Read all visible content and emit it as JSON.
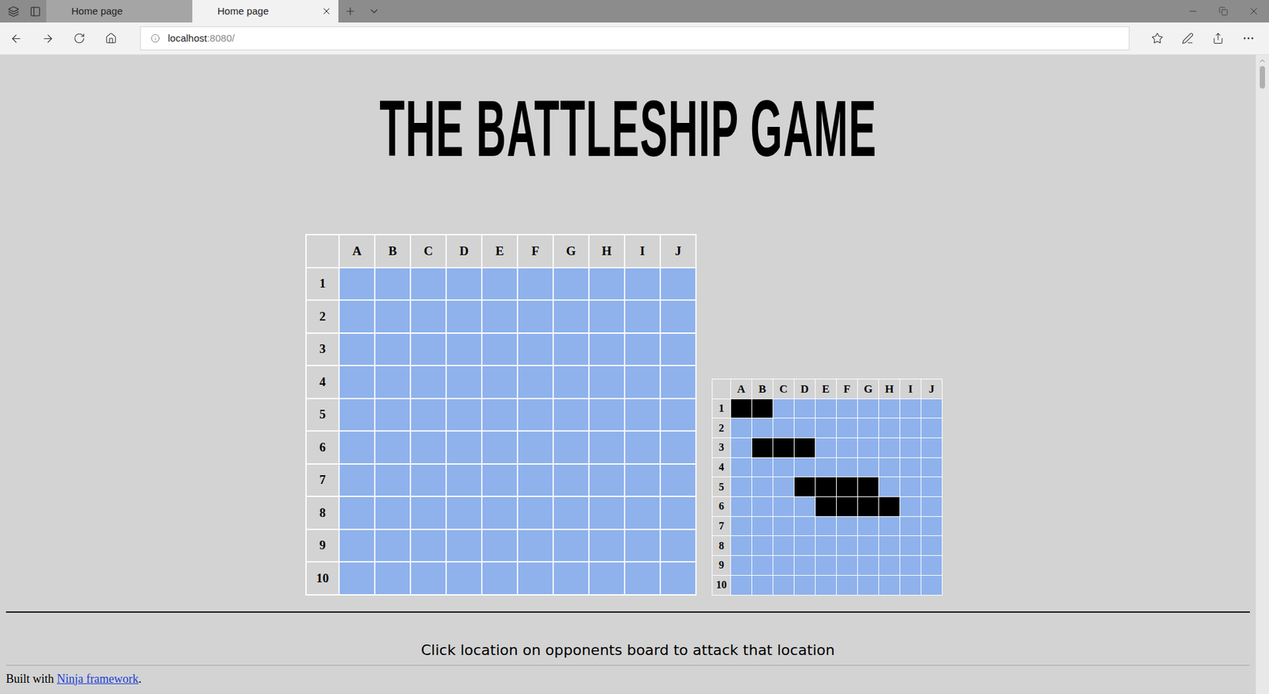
{
  "browser": {
    "tabs": [
      {
        "label": "Home page",
        "selected": false
      },
      {
        "label": "Home page",
        "selected": true
      }
    ],
    "url": {
      "host": "localhost",
      "rest": ":8080/"
    }
  },
  "title": "THE BATTLESHIP GAME",
  "opponent_board": {
    "columns": [
      "A",
      "B",
      "C",
      "D",
      "E",
      "F",
      "G",
      "H",
      "I",
      "J"
    ],
    "rows": [
      "1",
      "2",
      "3",
      "4",
      "5",
      "6",
      "7",
      "8",
      "9",
      "10"
    ]
  },
  "player_board": {
    "columns": [
      "A",
      "B",
      "C",
      "D",
      "E",
      "F",
      "G",
      "H",
      "I",
      "J"
    ],
    "rows": [
      {
        "label": "1",
        "ships": [
          true,
          true,
          false,
          false,
          false,
          false,
          false,
          false,
          false,
          false
        ]
      },
      {
        "label": "2",
        "ships": [
          false,
          false,
          false,
          false,
          false,
          false,
          false,
          false,
          false,
          false
        ]
      },
      {
        "label": "3",
        "ships": [
          false,
          true,
          true,
          true,
          false,
          false,
          false,
          false,
          false,
          false
        ]
      },
      {
        "label": "4",
        "ships": [
          false,
          false,
          false,
          false,
          false,
          false,
          false,
          false,
          false,
          false
        ]
      },
      {
        "label": "5",
        "ships": [
          false,
          false,
          false,
          true,
          true,
          true,
          true,
          false,
          false,
          false
        ]
      },
      {
        "label": "6",
        "ships": [
          false,
          false,
          false,
          false,
          true,
          true,
          true,
          true,
          false,
          false
        ]
      },
      {
        "label": "7",
        "ships": [
          false,
          false,
          false,
          false,
          false,
          false,
          false,
          false,
          false,
          false
        ]
      },
      {
        "label": "8",
        "ships": [
          false,
          false,
          false,
          false,
          false,
          false,
          false,
          false,
          false,
          false
        ]
      },
      {
        "label": "9",
        "ships": [
          false,
          false,
          false,
          false,
          false,
          false,
          false,
          false,
          false,
          false
        ]
      },
      {
        "label": "10",
        "ships": [
          false,
          false,
          false,
          false,
          false,
          false,
          false,
          false,
          false,
          false
        ]
      }
    ]
  },
  "instruction": "Click location on opponents board to attack that location",
  "footer": {
    "prefix": "Built with ",
    "link": "Ninja framework",
    "suffix": "."
  }
}
